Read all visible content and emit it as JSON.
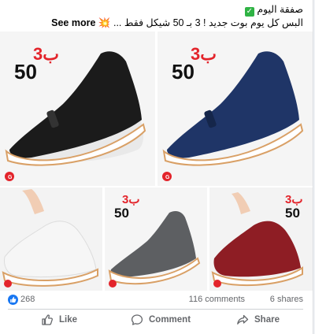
{
  "post": {
    "caption_line1": "صفقة اليوم",
    "caption_line2": "البس كل يوم بوت جديد ! 3 بـ 50 شيكل فقط",
    "see_more": "See more",
    "ellipsis": "...",
    "sparkle": "💥"
  },
  "gallery": {
    "badge_top": "3ب",
    "badge_bottom": "50",
    "images": [
      {
        "color": "black",
        "shoe_hex": "#1b1b1b"
      },
      {
        "color": "navy",
        "shoe_hex": "#1f3567"
      },
      {
        "color": "white",
        "shoe_hex": "#f4f4f4"
      },
      {
        "color": "gray",
        "shoe_hex": "#5d5f62"
      },
      {
        "color": "red",
        "shoe_hex": "#8e1d24"
      }
    ]
  },
  "stats": {
    "reactions": "268",
    "comments": "116 comments",
    "shares": "6 shares"
  },
  "actions": {
    "like": "Like",
    "comment": "Comment",
    "share": "Share"
  },
  "colors": {
    "accent": "#1877f2",
    "muted_text": "#65676b",
    "badge_red": "#e3242b"
  }
}
